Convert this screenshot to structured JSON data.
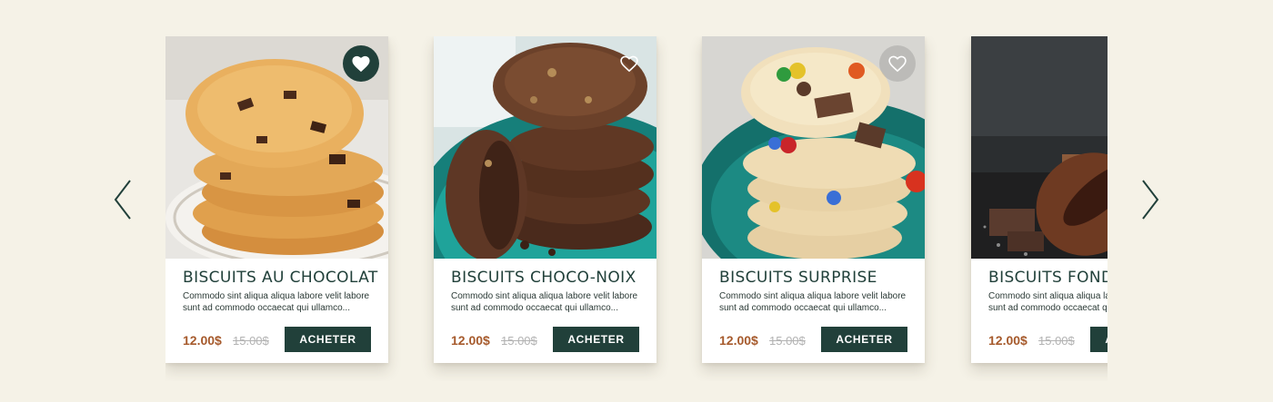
{
  "carousel": {
    "prev_icon": "chevron-left-icon",
    "next_icon": "chevron-right-icon",
    "products": [
      {
        "title": "BISCUITS AU CHOCOLAT",
        "description": "Commodo sint aliqua aliqua labore velit labore sunt ad commodo occaecat qui ullamco...",
        "price": "12.00$",
        "old_price": "15.00$",
        "button_label": "ACHETER",
        "favorite": true
      },
      {
        "title": "BISCUITS CHOCO-NOIX",
        "description": "Commodo sint aliqua aliqua labore velit labore sunt ad commodo occaecat qui ullamco...",
        "price": "12.00$",
        "old_price": "15.00$",
        "button_label": "ACHETER",
        "favorite": false
      },
      {
        "title": "BISCUITS SURPRISE",
        "description": "Commodo sint aliqua aliqua labore velit labore sunt ad commodo occaecat qui ullamco...",
        "price": "12.00$",
        "old_price": "15.00$",
        "button_label": "ACHETER",
        "favorite": false
      },
      {
        "title": "BISCUITS FONDA",
        "description": "Commodo sint aliqua aliqua labore velit labore sunt ad commodo occaecat qui ullamco...",
        "price": "12.00$",
        "old_price": "15.00$",
        "button_label": "ACHETER",
        "favorite": false
      }
    ]
  },
  "colors": {
    "background": "#f5f2e7",
    "brand_dark_green": "#21403a",
    "price": "#a65a2c",
    "old_price": "#b3b3b3"
  }
}
